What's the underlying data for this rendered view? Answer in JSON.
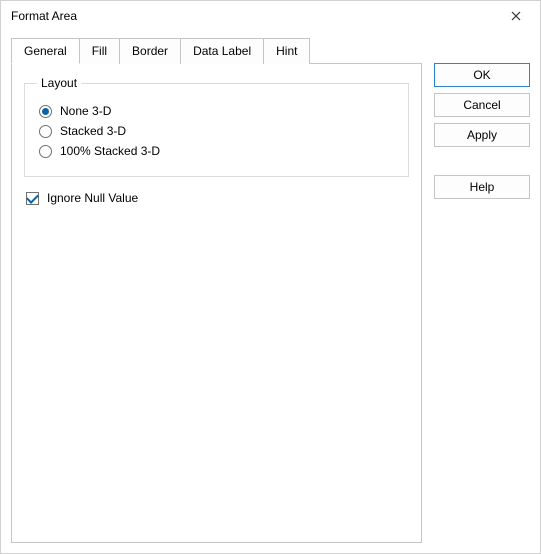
{
  "window": {
    "title": "Format Area"
  },
  "tabs": [
    {
      "label": "General",
      "active": true
    },
    {
      "label": "Fill",
      "active": false
    },
    {
      "label": "Border",
      "active": false
    },
    {
      "label": "Data Label",
      "active": false
    },
    {
      "label": "Hint",
      "active": false
    }
  ],
  "general": {
    "layout": {
      "legend": "Layout",
      "options": [
        {
          "label": "None 3-D",
          "selected": true
        },
        {
          "label": "Stacked 3-D",
          "selected": false
        },
        {
          "label": "100% Stacked 3-D",
          "selected": false
        }
      ]
    },
    "ignore_null": {
      "label": "Ignore Null Value",
      "checked": true
    }
  },
  "buttons": {
    "ok": "OK",
    "cancel": "Cancel",
    "apply": "Apply",
    "help": "Help"
  }
}
